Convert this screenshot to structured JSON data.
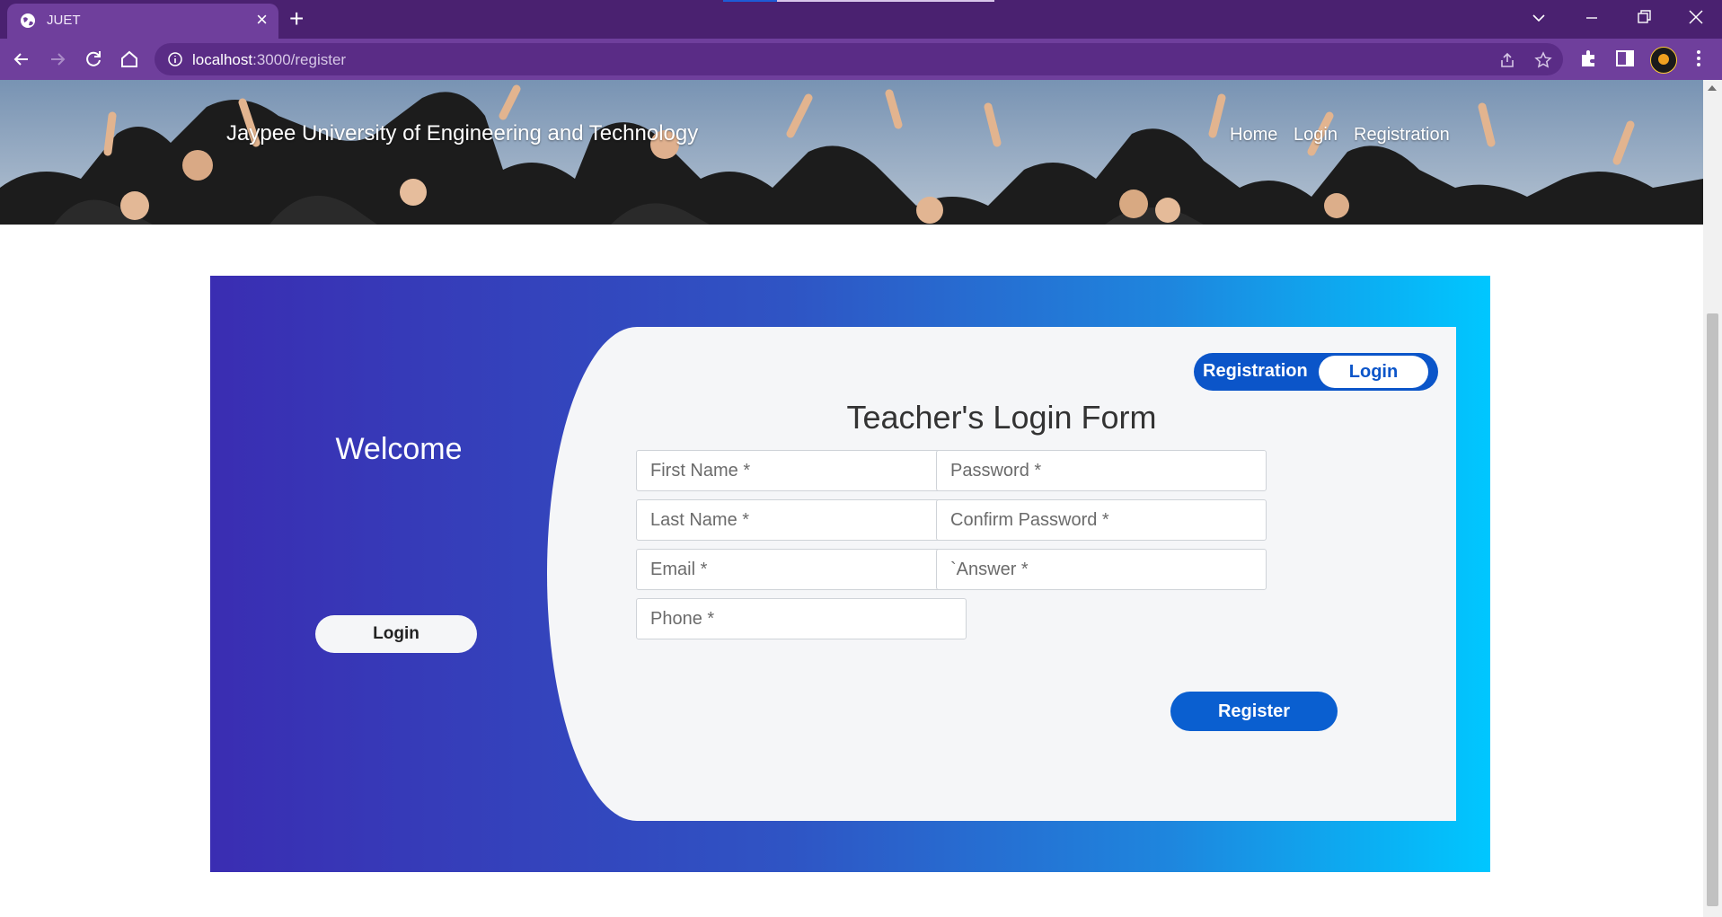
{
  "browser": {
    "tab_title": "JUET",
    "url_host": "localhost",
    "url_path": ":3000/register"
  },
  "header": {
    "site_title": "Jaypee University of Engineering and Technology",
    "nav": [
      "Home",
      "Login",
      "Registration"
    ]
  },
  "side": {
    "welcome": "Welcome",
    "login_button": "Login"
  },
  "form": {
    "toggle_registration": "Registration",
    "toggle_login": "Login",
    "title": "Teacher's Login Form",
    "first_name_placeholder": "First Name *",
    "last_name_placeholder": "Last Name *",
    "email_placeholder": "Email *",
    "phone_placeholder": "Phone *",
    "password_placeholder": "Password *",
    "confirm_password_placeholder": "Confirm Password *",
    "answer_placeholder": "`Answer *",
    "register_button": "Register"
  },
  "colors": {
    "browser_frame": "#4a2170",
    "card_gradient_start": "#3a2db2",
    "card_gradient_end": "#00c7ff",
    "accent_blue": "#0a5fd0"
  }
}
